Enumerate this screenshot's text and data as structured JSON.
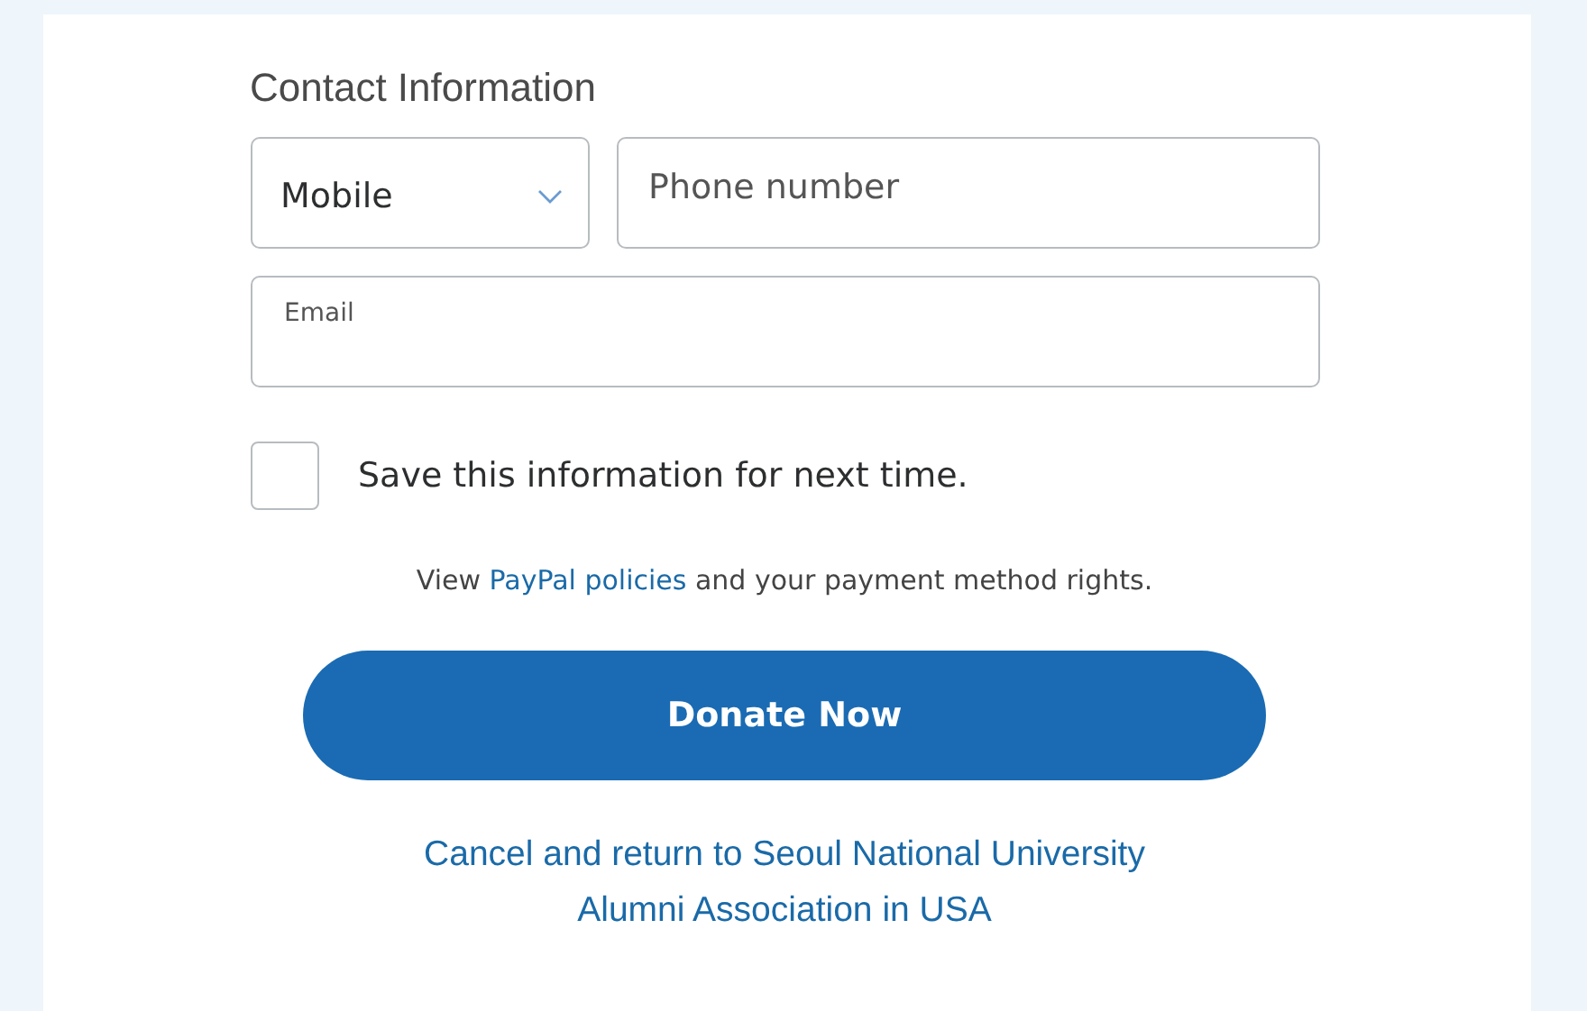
{
  "section_title": "Contact Information",
  "phone_type": {
    "value": "Mobile"
  },
  "phone": {
    "placeholder": "Phone number"
  },
  "email": {
    "label": "Email"
  },
  "save_info": {
    "label": "Save this information for next time.",
    "checked": false
  },
  "policy": {
    "before": "View ",
    "link": "PayPal policies",
    "after": " and your payment method rights."
  },
  "donate_button": "Donate Now",
  "cancel_link": [
    "Cancel and return to Seoul National University",
    "Alumni Association in USA"
  ]
}
